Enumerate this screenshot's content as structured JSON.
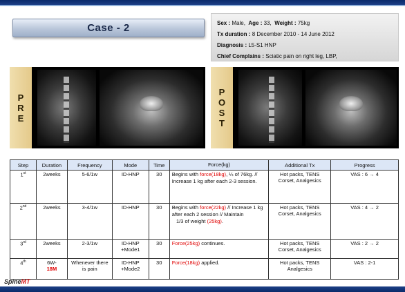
{
  "case_title": "Case - 2",
  "info": {
    "sex_label": "Sex :",
    "sex_value": "Male,",
    "age_label": "Age :",
    "age_value": "33,",
    "weight_label": "Weight :",
    "weight_value": "75kg",
    "tx_label": "Tx duration :",
    "tx_value": "8  December 2010  - 14 June 2012",
    "diagnosis_label": "Diagnosis :",
    "diagnosis_value": "L5-S1  HNP",
    "complaint_label": "Chief Complains :",
    "complaint_value": "Sciatic pain on right leg, LBP,"
  },
  "imaging": {
    "pre_label": [
      "P",
      "R",
      "E"
    ],
    "post_label": [
      "P",
      "O",
      "S",
      "T"
    ]
  },
  "table": {
    "headers": [
      "Step",
      "Duration",
      "Frequency",
      "Mode",
      "Time",
      "Force(kg)",
      "Additional Tx",
      "Progress"
    ],
    "rows": [
      {
        "step": "1",
        "step_sup": "st",
        "duration": "2weeks",
        "frequency": "5-6/1w",
        "mode": "ID-HNP",
        "time": "30",
        "force_pre": "Begins with ",
        "force_red": "force(18kg)",
        "force_post": ", ¼ of 76kg. // Increase 1 kg after each 2-3  session.",
        "additional": "Hot packs, TENS Corset, Analgesics",
        "progress": "VAS : 6 → 4"
      },
      {
        "step": "2",
        "step_sup": "nd",
        "duration": "2weeks",
        "frequency": "3-4/1w",
        "mode": "ID-HNP",
        "time": "30",
        "force_pre": "Begins with ",
        "force_red": "force(22kg)",
        "force_post": " // Increase 1 kg after each 2 session  // Maintain",
        "force_line2_pre": "1/3  of weight ",
        "force_line2_red": "(25kg)",
        "force_line2_post": ".",
        "additional": "Hot packs, TENS Corset, Analgesics",
        "progress": "VAS : 4 → 2"
      },
      {
        "step": "3",
        "step_sup": "rd",
        "duration": "2weeks",
        "frequency": "2-3/1w",
        "mode": "ID-HNP +Mode1",
        "time": "30",
        "force_red": "Force(25kg)",
        "force_post": " continues.",
        "additional": "Hot packs, TENS Corset, Analgesics",
        "progress": "VAS : 2 → 2"
      },
      {
        "step": "4",
        "step_sup": "th",
        "duration_line1": "6W-",
        "duration_line2": "18M",
        "frequency": "Whenever there  is pain",
        "mode": "ID-HNP +Mode2",
        "time": "30",
        "force_red": "Force(18kg)",
        "force_post": " applied.",
        "additional": "Hot packs, TENS Analgesics",
        "progress": "VAS : 2-1"
      }
    ]
  },
  "logo": {
    "text_a": "Sp",
    "text_b": "i",
    "text_c": "ne",
    "text_d": "MT"
  }
}
